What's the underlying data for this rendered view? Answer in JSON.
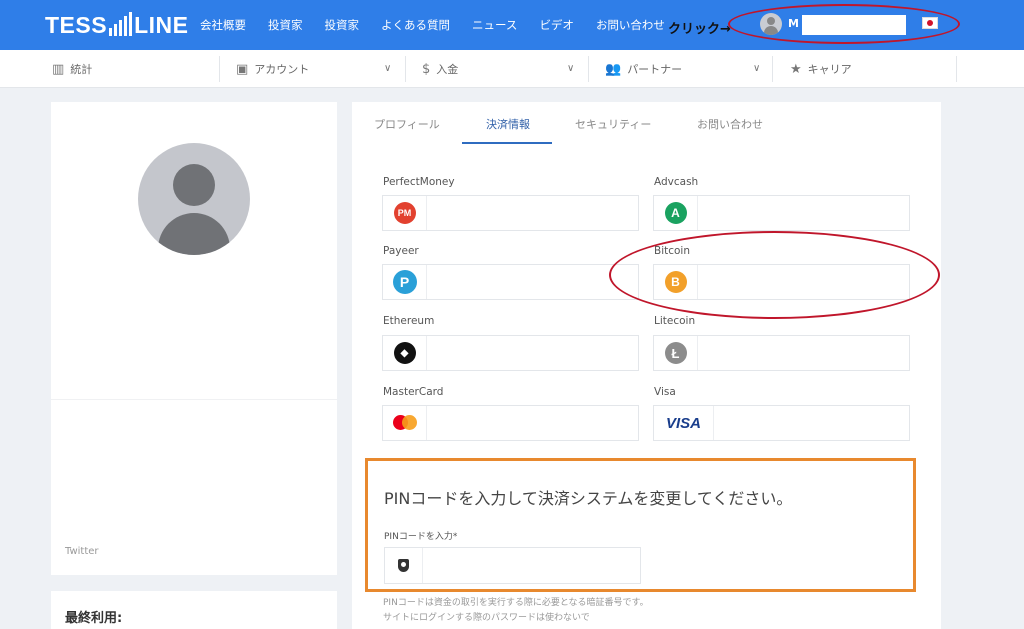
{
  "brand": {
    "logo_left": "TESS",
    "logo_right": "LINE"
  },
  "nav": {
    "items": [
      "会社概要",
      "投資家",
      "投資家",
      "よくある質問",
      "ニュース",
      "ビデオ",
      "お問い合わせ"
    ],
    "click_note": "クリック→",
    "user_initial": "M"
  },
  "subnav": {
    "stats": "統計",
    "account": "アカウント",
    "deposit": "入金",
    "partner": "パートナー",
    "career": "キャリア"
  },
  "profile": {
    "twitter": "Twitter",
    "last_used": "最終利用:"
  },
  "tabs": {
    "profile": "プロフィール",
    "payment": "決済情報",
    "security": "セキュリティー",
    "contact": "お問い合わせ"
  },
  "payment": {
    "perfectmoney": "PerfectMoney",
    "advcash": "Advcash",
    "payeer": "Payeer",
    "bitcoin": "Bitcoin",
    "ethereum": "Ethereum",
    "litecoin": "Litecoin",
    "mastercard": "MasterCard",
    "visa": "Visa",
    "pm_glyph": "PM",
    "advcash_glyph": "A",
    "payeer_glyph": "P",
    "bitcoin_glyph": "B",
    "eth_glyph": "◆",
    "ltc_glyph": "Ł",
    "visa_glyph": "VISA"
  },
  "pin": {
    "title": "PINコードを入力して決済システムを変更してください。",
    "label": "PINコードを入力*",
    "note": "PINコードは資金の取引を実行する際に必要となる暗証番号です。サイトにログインする際のパスワードは使わないで"
  },
  "colors": {
    "nav_blue": "#2f7ee8",
    "annotation_red": "#c0162b",
    "annotation_orange": "#e8892e",
    "perfectmoney": "#e2412f",
    "advcash": "#1aa260",
    "payeer": "#2aa0d8",
    "bitcoin": "#f2a02a",
    "litecoin": "#8c8c8c",
    "visa": "#1a3e8c"
  }
}
